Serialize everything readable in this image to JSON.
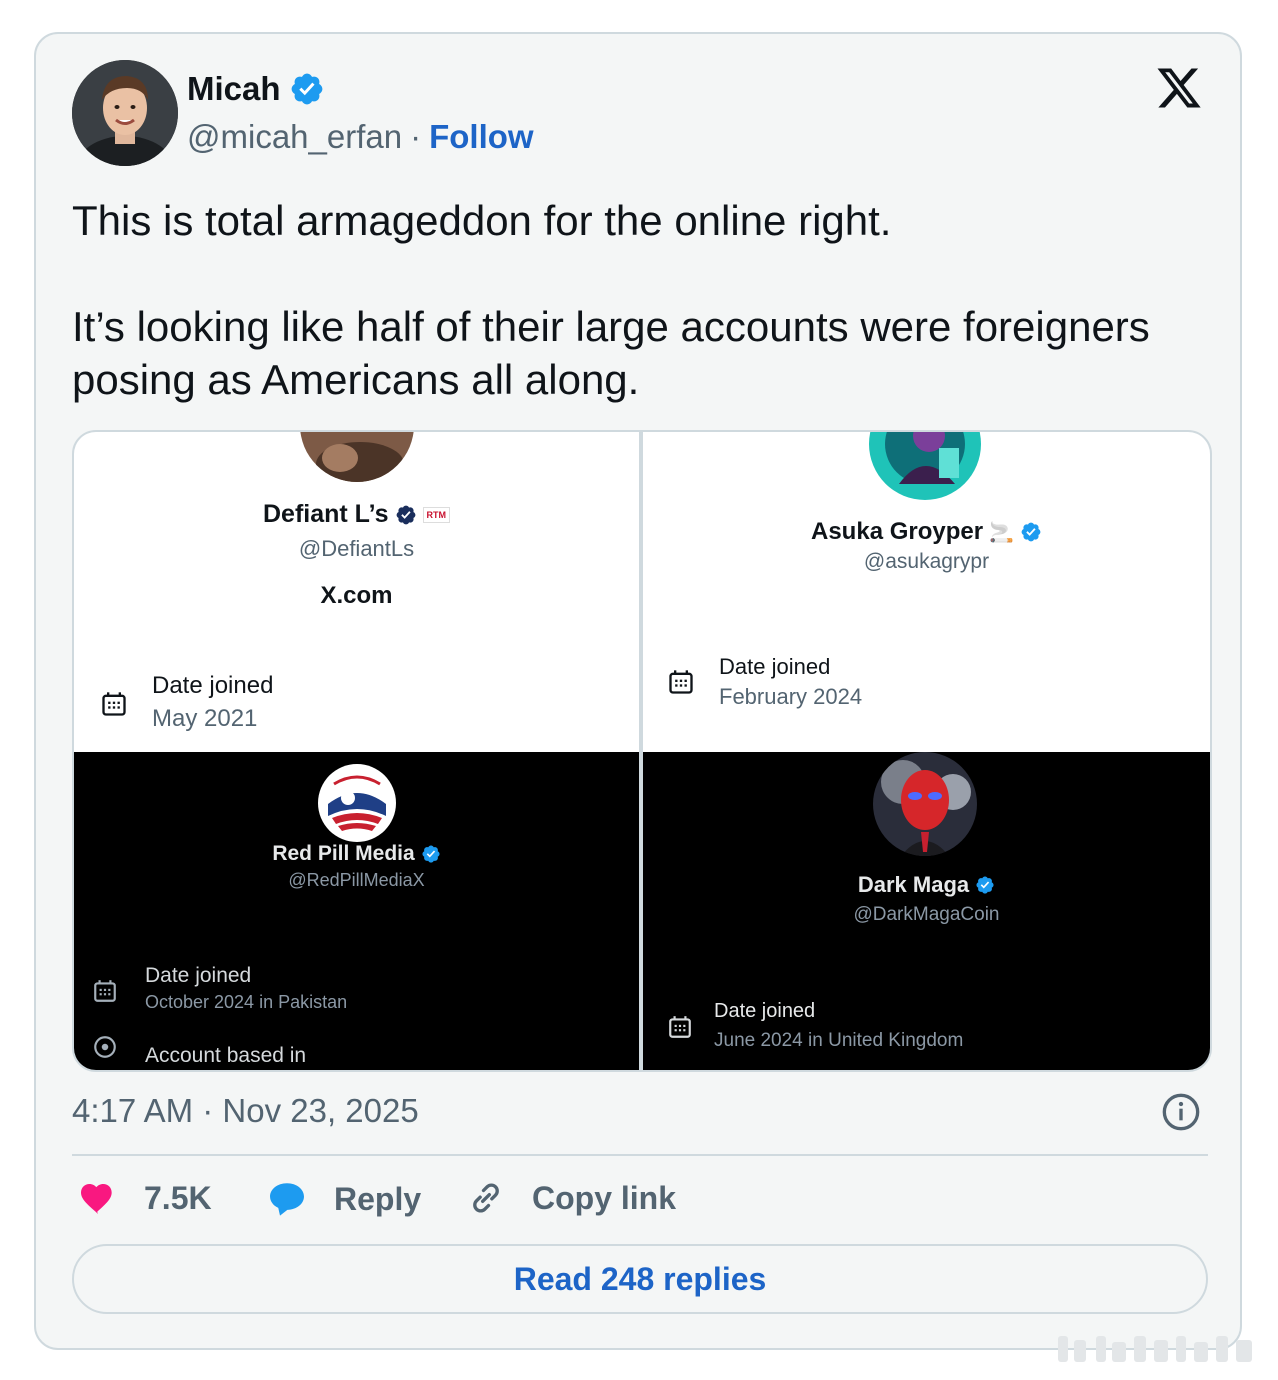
{
  "author": {
    "name": "Micah",
    "handle": "@micah_erfan",
    "separator": "·",
    "follow_label": "Follow"
  },
  "tweet": {
    "text": "This is total armageddon for the online right.\n\nIt’s looking like half of their large accounts were foreigners posing as Americans all along."
  },
  "media": {
    "panels": [
      {
        "name": "Defiant L’s",
        "handle": "@DefiantLs",
        "badge": "RTM",
        "link": "X.com",
        "date_joined_label": "Date joined",
        "date_joined_value": "May 2021"
      },
      {
        "name": "Asuka Groyper",
        "name_emoji": "🚬",
        "handle": "@asukagrypr",
        "date_joined_label": "Date joined",
        "date_joined_value": "February 2024"
      },
      {
        "name": "Red Pill Media",
        "handle": "@RedPillMediaX",
        "date_joined_label": "Date joined",
        "date_joined_value": "October 2024 in Pakistan",
        "account_based_label": "Account based in"
      },
      {
        "name": "Dark Maga",
        "handle": "@DarkMagaCoin",
        "date_joined_label": "Date joined",
        "date_joined_value": "June 2024 in United Kingdom"
      }
    ]
  },
  "timestamp": "4:17 AM · Nov 23, 2025",
  "actions": {
    "like_count": "7.5K",
    "reply_label": "Reply",
    "copy_link_label": "Copy link"
  },
  "read_replies_label": "Read 248 replies",
  "colors": {
    "verified_blue": "#1d9bf0",
    "link_blue": "#1d64c7",
    "like_pink": "#f91880",
    "card_bg": "#f4f6f6",
    "border": "#cfd9de",
    "secondary_text": "#536471"
  },
  "icons": [
    "verified-badge-icon",
    "x-logo-icon",
    "calendar-icon",
    "info-icon",
    "heart-icon",
    "reply-bubble-icon",
    "link-icon"
  ]
}
